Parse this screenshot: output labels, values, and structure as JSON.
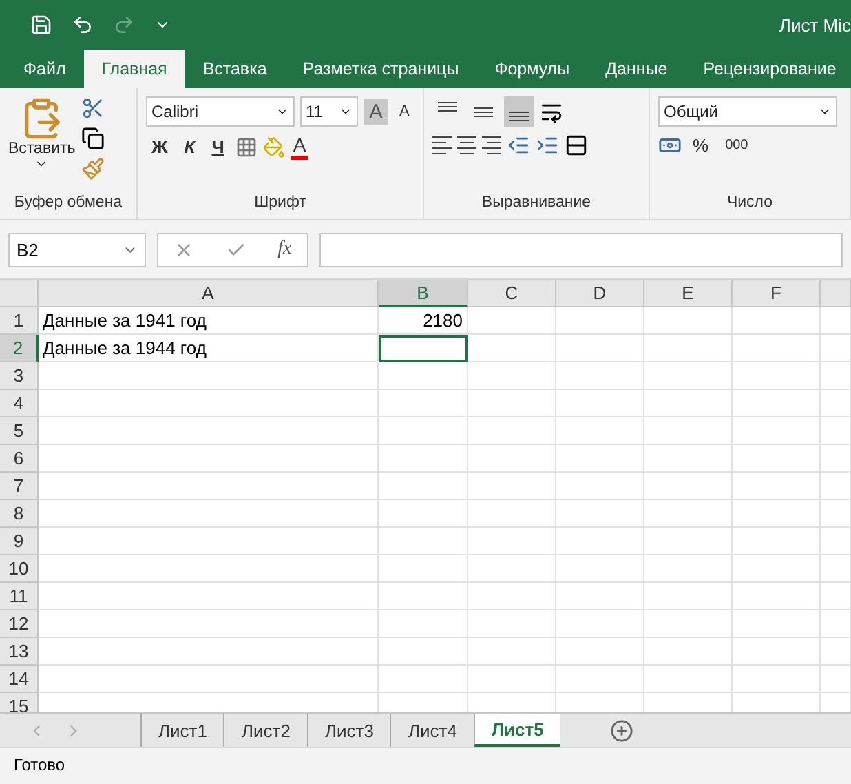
{
  "window": {
    "title": "Лист Mic"
  },
  "menu_tabs": [
    {
      "label": "Файл",
      "selected": false
    },
    {
      "label": "Главная",
      "selected": true
    },
    {
      "label": "Вставка",
      "selected": false
    },
    {
      "label": "Разметка страницы",
      "selected": false
    },
    {
      "label": "Формулы",
      "selected": false
    },
    {
      "label": "Данные",
      "selected": false
    },
    {
      "label": "Рецензирование",
      "selected": false
    }
  ],
  "ribbon": {
    "clipboard": {
      "paste_label": "Вставить",
      "group_label": "Буфер обмена"
    },
    "font": {
      "font_name": "Calibri",
      "font_size": "11",
      "grow_font": "A",
      "shrink_font": "A",
      "font_color": "A",
      "bold": "Ж",
      "italic": "К",
      "underline": "Ч",
      "group_label": "Шрифт"
    },
    "alignment": {
      "vertical_align": [
        {
          "kind": "top",
          "selected": false
        },
        {
          "kind": "middle",
          "selected": false
        },
        {
          "kind": "bottom",
          "selected": true
        }
      ],
      "group_label": "Выравнивание"
    },
    "number": {
      "format": "Общий",
      "percent": "%",
      "thousands": "000",
      "group_label": "Число"
    }
  },
  "name_box": "B2",
  "formula_fx": "fx",
  "sheet": {
    "columns": [
      {
        "label": "A",
        "selected": false
      },
      {
        "label": "B",
        "selected": true
      },
      {
        "label": "C",
        "selected": false
      },
      {
        "label": "D",
        "selected": false
      },
      {
        "label": "E",
        "selected": false
      },
      {
        "label": "F",
        "selected": false
      }
    ],
    "rows": [
      {
        "label": "1",
        "selected": false,
        "cells": {
          "A": {
            "kind": "text",
            "text": "Данные за 1941 год"
          },
          "B": {
            "kind": "number",
            "text": "2180"
          }
        }
      },
      {
        "label": "2",
        "selected": true,
        "cells": {
          "A": {
            "kind": "text",
            "text": "Данные за 1944 год"
          }
        }
      },
      {
        "label": "3",
        "selected": false
      },
      {
        "label": "4",
        "selected": false
      },
      {
        "label": "5",
        "selected": false
      },
      {
        "label": "6",
        "selected": false
      },
      {
        "label": "7",
        "selected": false
      },
      {
        "label": "8",
        "selected": false
      },
      {
        "label": "9",
        "selected": false
      },
      {
        "label": "10",
        "selected": false
      },
      {
        "label": "11",
        "selected": false
      },
      {
        "label": "12",
        "selected": false
      },
      {
        "label": "13",
        "selected": false
      },
      {
        "label": "14",
        "selected": false
      },
      {
        "label": "15",
        "selected": false
      }
    ]
  },
  "sheet_tabs": [
    {
      "label": "Лист1",
      "selected": false
    },
    {
      "label": "Лист2",
      "selected": false
    },
    {
      "label": "Лист3",
      "selected": false
    },
    {
      "label": "Лист4",
      "selected": false
    },
    {
      "label": "Лист5",
      "selected": true
    }
  ],
  "status": "Готово"
}
